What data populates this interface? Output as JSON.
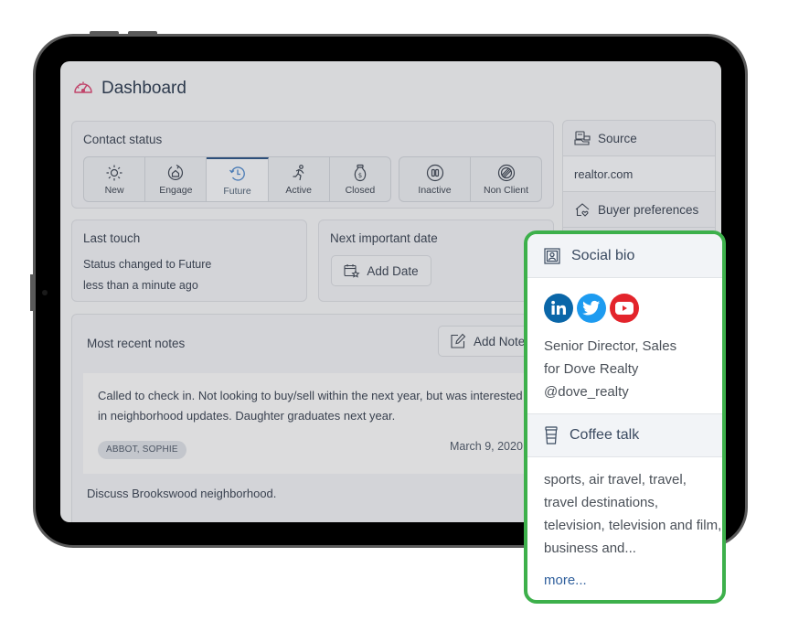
{
  "page": {
    "title": "Dashboard",
    "title_icon": "dashboard-gauge-icon",
    "accent_color": "#c0456b"
  },
  "contact_status": {
    "label": "Contact status",
    "selected": "Future",
    "group_primary": [
      {
        "label": "New",
        "icon": "sun-icon"
      },
      {
        "label": "Engage",
        "icon": "engage-house-icon"
      },
      {
        "label": "Future",
        "icon": "history-clock-icon"
      },
      {
        "label": "Active",
        "icon": "running-person-icon"
      },
      {
        "label": "Closed",
        "icon": "money-bag-icon"
      }
    ],
    "group_secondary": [
      {
        "label": "Inactive",
        "icon": "pause-circle-icon"
      },
      {
        "label": "Non Client",
        "icon": "prohibited-icon"
      }
    ]
  },
  "last_touch": {
    "label": "Last touch",
    "line1": "Status changed to Future",
    "line2": "less than a minute ago"
  },
  "next_date": {
    "label": "Next important date",
    "button": "Add Date"
  },
  "source": {
    "label": "Source",
    "value": "realtor.com",
    "buyer_preferences": "Buyer preferences"
  },
  "notes": {
    "label": "Most recent notes",
    "add_button": "Add Note",
    "items": [
      {
        "text": "Called to check in. Not looking to buy/sell within the next year, but was interested in neighborhood updates. Daughter graduates next year.",
        "tag": "ABBOT, SOPHIE",
        "date": "March 9, 2020"
      },
      {
        "text": "Discuss Brookswood neighborhood."
      }
    ]
  },
  "popup": {
    "border_color": "#3db04b",
    "social_bio": {
      "title": "Social bio",
      "networks": [
        {
          "name": "LinkedIn",
          "icon": "linkedin-icon",
          "color": "#0a66a8"
        },
        {
          "name": "Twitter",
          "icon": "twitter-icon",
          "color": "#1d9bf0"
        },
        {
          "name": "YouTube",
          "icon": "youtube-icon",
          "color": "#e3242b"
        }
      ],
      "line1": "Senior Director, Sales",
      "line2": "for Dove Realty",
      "line3": "@dove_realty"
    },
    "coffee_talk": {
      "title": "Coffee talk",
      "text": "sports, air travel, travel, travel destinations, television, television and film, business and...",
      "more": "more..."
    }
  }
}
